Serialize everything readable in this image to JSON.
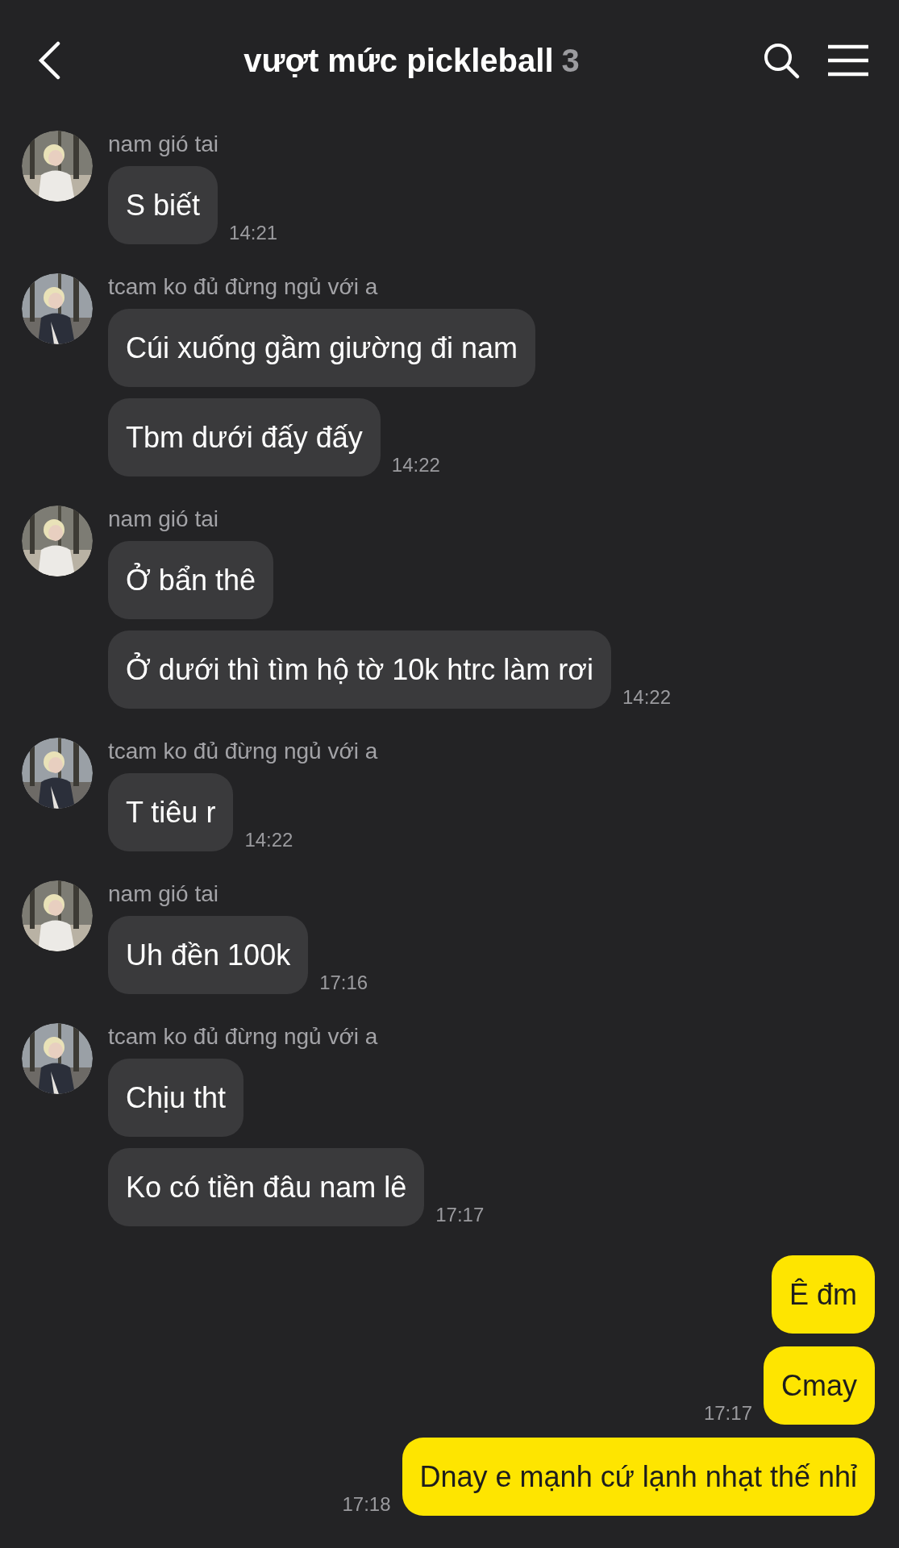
{
  "header": {
    "title": "vượt mức pickleball",
    "member_count": "3"
  },
  "groups": [
    {
      "kind": "incoming",
      "sender": "nam gió tai",
      "messages": [
        {
          "text": "S biết",
          "time": "14:21"
        }
      ]
    },
    {
      "kind": "incoming",
      "sender": "tcam ko đủ đừng ngủ với a",
      "messages": [
        {
          "text": "Cúi xuống gầm giường đi nam"
        },
        {
          "text": "Tbm dưới đấy đấy",
          "time": "14:22"
        }
      ]
    },
    {
      "kind": "incoming",
      "sender": "nam gió tai",
      "messages": [
        {
          "text": "Ở bẩn thê"
        },
        {
          "text": "Ở dưới thì tìm hộ tờ 10k htrc làm rơi",
          "time": "14:22"
        }
      ]
    },
    {
      "kind": "incoming",
      "sender": "tcam ko đủ đừng ngủ với a",
      "messages": [
        {
          "text": "T tiêu r",
          "time": "14:22"
        }
      ]
    },
    {
      "kind": "incoming",
      "sender": "nam gió tai",
      "messages": [
        {
          "text": "Uh đền 100k",
          "time": "17:16"
        }
      ]
    },
    {
      "kind": "incoming",
      "sender": "tcam ko đủ đừng ngủ với a",
      "messages": [
        {
          "text": "Chịu tht"
        },
        {
          "text": "Ko có tiền đâu nam lê",
          "time": "17:17"
        }
      ]
    },
    {
      "kind": "outgoing",
      "messages": [
        {
          "text": "Ê đm"
        },
        {
          "text": "Cmay",
          "time": "17:17"
        },
        {
          "text": "Dnay e mạnh cứ lạnh nhạt thế nhỉ",
          "time": "17:18"
        }
      ]
    }
  ]
}
